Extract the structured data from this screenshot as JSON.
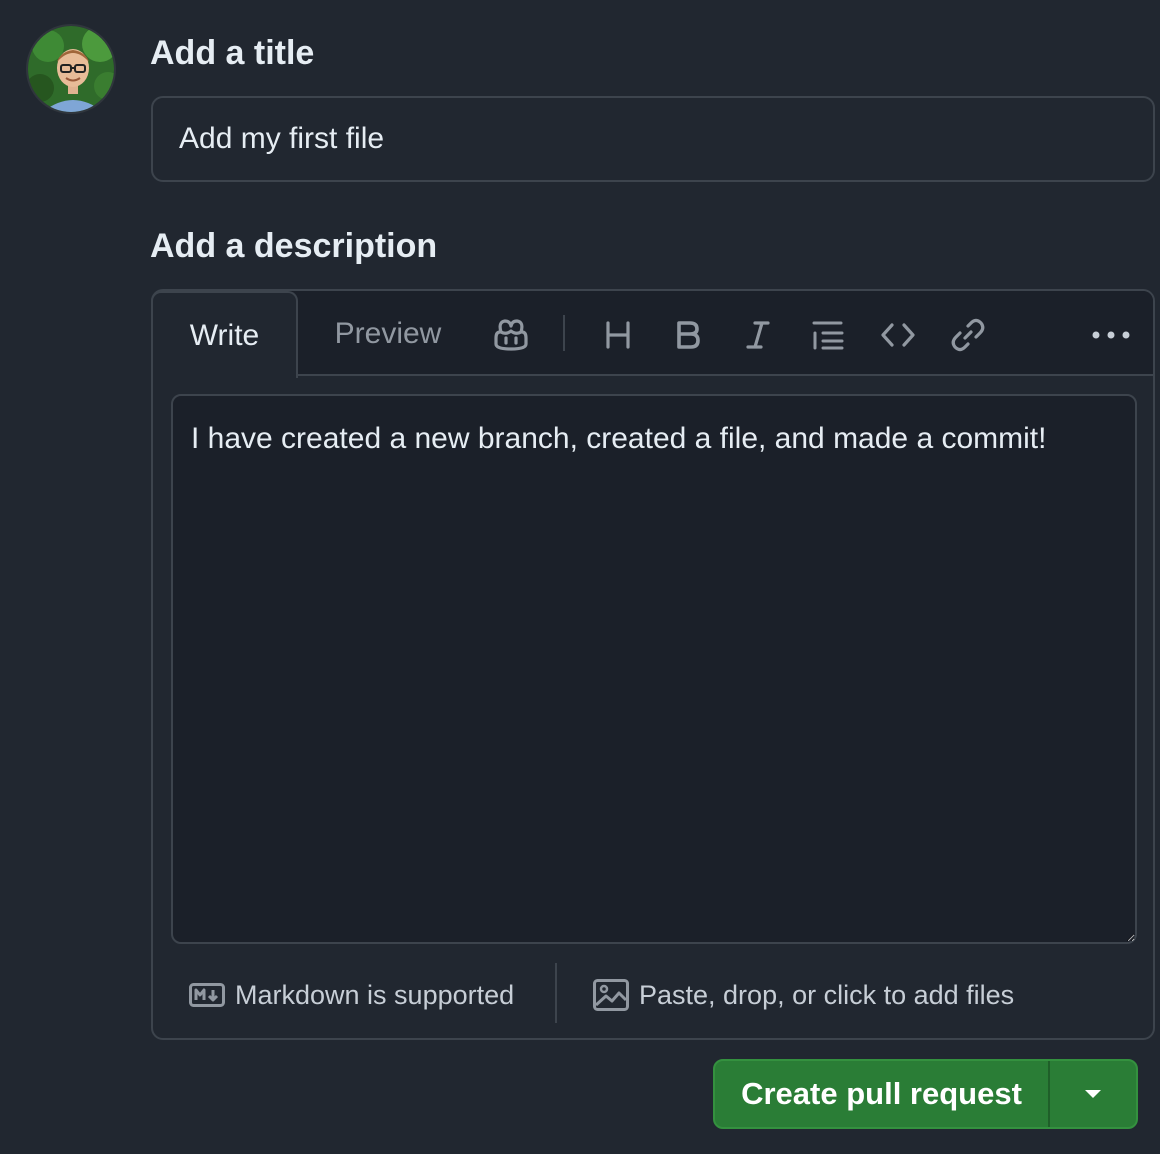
{
  "form": {
    "title_heading": "Add a title",
    "title_value": "Add my first file",
    "description_heading": "Add a description"
  },
  "editor": {
    "tabs": [
      {
        "label": "Write",
        "active": true
      },
      {
        "label": "Preview",
        "active": false
      }
    ],
    "toolbar": [
      "copilot-icon",
      "heading-icon",
      "bold-icon",
      "italic-icon",
      "list-icon",
      "code-icon",
      "link-icon",
      "more-icon"
    ],
    "description_value": "I have created a new branch, created a file, and made a commit!",
    "markdown_note": "Markdown is supported",
    "attach_note": "Paste, drop, or click to add files"
  },
  "actions": {
    "submit_label": "Create pull request"
  },
  "colors": {
    "background": "#212730",
    "button_green": "#2a7d36",
    "border": "#3d444d",
    "text": "#e6edf3",
    "muted_text": "#9198a1"
  }
}
